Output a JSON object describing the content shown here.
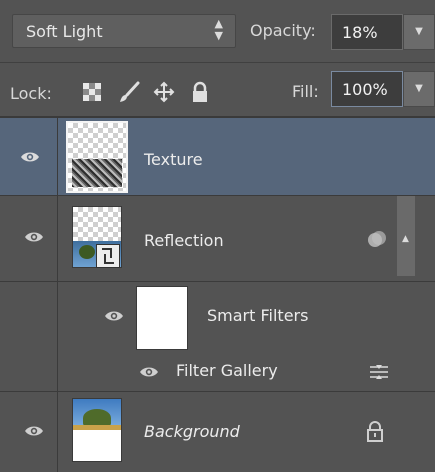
{
  "blend_mode": {
    "selected": "Soft Light"
  },
  "opacity": {
    "label": "Opacity:",
    "value": "18%"
  },
  "lock": {
    "label": "Lock:"
  },
  "fill": {
    "label": "Fill:",
    "value": "100%"
  },
  "layers": [
    {
      "name": "Texture",
      "selected": true
    },
    {
      "name": "Reflection",
      "selected": false
    },
    {
      "name": "Smart Filters"
    },
    {
      "name": "Filter Gallery"
    },
    {
      "name": "Background",
      "locked": true
    }
  ],
  "colors": {
    "panel": "#535353",
    "selected_layer": "#56667b",
    "dark_field": "#3d3d3d"
  },
  "icons": [
    "eye-icon",
    "lock-transparent-icon",
    "lock-brush-icon",
    "lock-move-icon",
    "lock-all-icon",
    "smart-object-icon",
    "filter-options-icon",
    "lock-icon"
  ]
}
